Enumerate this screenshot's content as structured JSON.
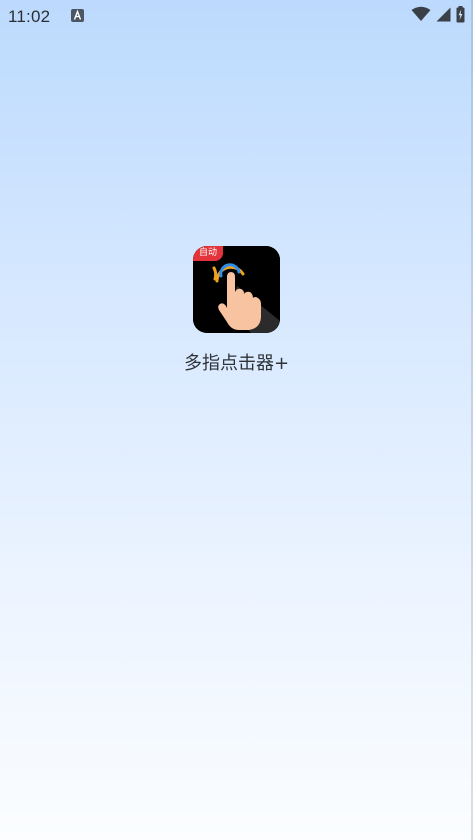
{
  "status_bar": {
    "time": "11:02",
    "notification_icon": "keyboard-a-icon",
    "icons": [
      "wifi-icon",
      "signal-icon",
      "battery-charging-icon"
    ]
  },
  "splash": {
    "app_name": "多指点击器+",
    "badge": "自动",
    "icon": "tap-hand-icon",
    "colors": {
      "badge": "#e3343b",
      "icon_bg": "#000000",
      "hand": "#f8c3a0",
      "ring_orange": "#f0a31e",
      "ring_blue": "#2f8ee8"
    }
  }
}
